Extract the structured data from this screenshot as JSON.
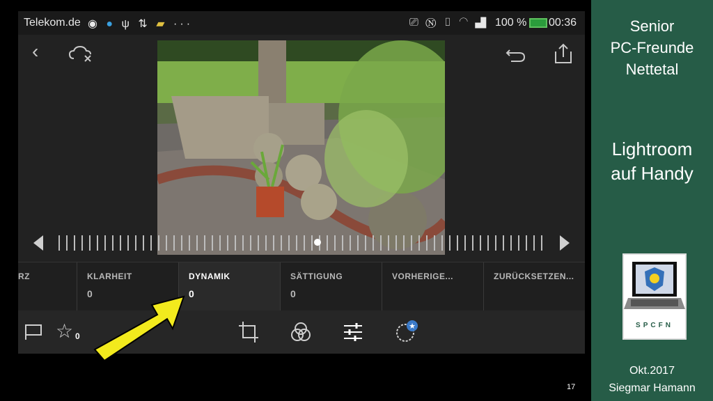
{
  "statusbar": {
    "carrier": "Telekom.de",
    "icons_left": [
      "whatsapp-icon",
      "globe-icon",
      "usb-icon",
      "arrows-icon",
      "folder-icon"
    ],
    "more": "···",
    "battery": "100 %",
    "time": "00:36"
  },
  "params": [
    {
      "label": "RZ",
      "value": ""
    },
    {
      "label": "KLARHEIT",
      "value": "0"
    },
    {
      "label": "DYNAMIK",
      "value": "0",
      "active": true
    },
    {
      "label": "SÄTTIGUNG",
      "value": "0"
    },
    {
      "label": "VORHERIGE...",
      "value": ""
    },
    {
      "label": "ZURÜCKSETZEN...",
      "value": ""
    }
  ],
  "rating": {
    "count": "0"
  },
  "slide_number": "17",
  "sidebar": {
    "line1": "Senior",
    "line2": "PC-Freunde",
    "line3": "Nettetal",
    "topic1": "Lightroom",
    "topic2": "auf Handy",
    "logo_text": "SPCFN",
    "date": "Okt.2017",
    "author": "Siegmar Hamann"
  },
  "colors": {
    "sidebar": "#265c47",
    "arrow": "#f2ea1d",
    "app_bg": "#232323"
  }
}
